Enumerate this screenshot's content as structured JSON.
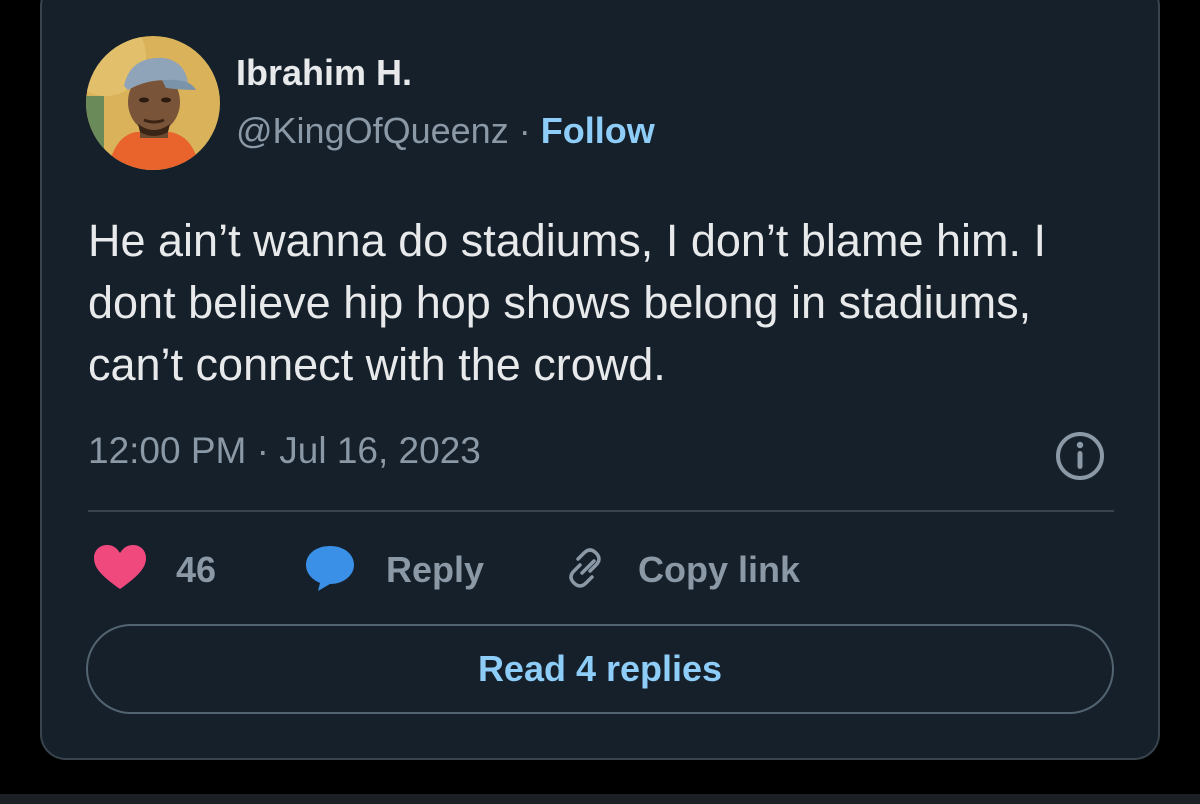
{
  "tweet": {
    "author": {
      "name": "Ibrahim H.",
      "handle": "@KingOfQueenz",
      "separator": "·",
      "follow_label": "Follow"
    },
    "text": "He ain’t wanna do stadiums, I don’t blame him. I dont believe hip hop shows belong in stadiums, can’t connect with the crowd.",
    "timestamp": "12:00 PM · Jul 16, 2023",
    "actions": {
      "like_count": "46",
      "reply_label": "Reply",
      "copy_link_label": "Copy link"
    },
    "read_replies_label": "Read 4 replies"
  },
  "icons": {
    "like": "heart-icon",
    "reply": "speech-bubble-icon",
    "copy_link": "link-icon",
    "info": "info-icon"
  },
  "colors": {
    "background": "#15202b",
    "text_primary": "#e7e9ea",
    "text_secondary": "#8b98a5",
    "link": "#8ecdf8",
    "like": "#f0497e",
    "reply": "#3a8fe7",
    "border": "#38444d"
  }
}
